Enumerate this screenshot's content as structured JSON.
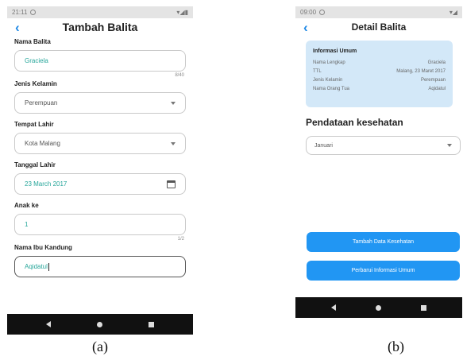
{
  "screen_a": {
    "status_time": "21:11",
    "title": "Tambah Balita",
    "fields": [
      {
        "label": "Nama Balita",
        "value": "Graciela",
        "counter": "8/40"
      },
      {
        "label": "Jenis Kelamin",
        "value": "Perempuan"
      },
      {
        "label": "Tempat Lahir",
        "value": "Kota Malang"
      },
      {
        "label": "Tanggal Lahir",
        "value": "23 March 2017"
      },
      {
        "label": "Anak ke",
        "value": "1",
        "counter": "1/2"
      },
      {
        "label": "Nama Ibu Kandung",
        "value": "Aqidatul"
      }
    ]
  },
  "screen_b": {
    "status_time": "09:00",
    "title": "Detail Balita",
    "card": {
      "title": "Informasi Umum",
      "rows": [
        {
          "key": "Nama Lengkap",
          "value": "Graciela"
        },
        {
          "key": "TTL",
          "value": "Malang, 23 Maret 2017"
        },
        {
          "key": "Jenis Kelamin",
          "value": "Perempuan"
        },
        {
          "key": "Nama Orang Tua",
          "value": "Aqidatul"
        }
      ]
    },
    "section_title": "Pendataan kesehatan",
    "month_select": "Januari",
    "buttons": {
      "add": "Tambah Data Kesehatan",
      "update": "Perbarui Informasi Umum"
    }
  },
  "captions": {
    "a": "(a)",
    "b": "(b)"
  },
  "colors": {
    "accent": "#2196f3",
    "text_value": "#26a69a",
    "card_bg": "#d3e8f8"
  }
}
